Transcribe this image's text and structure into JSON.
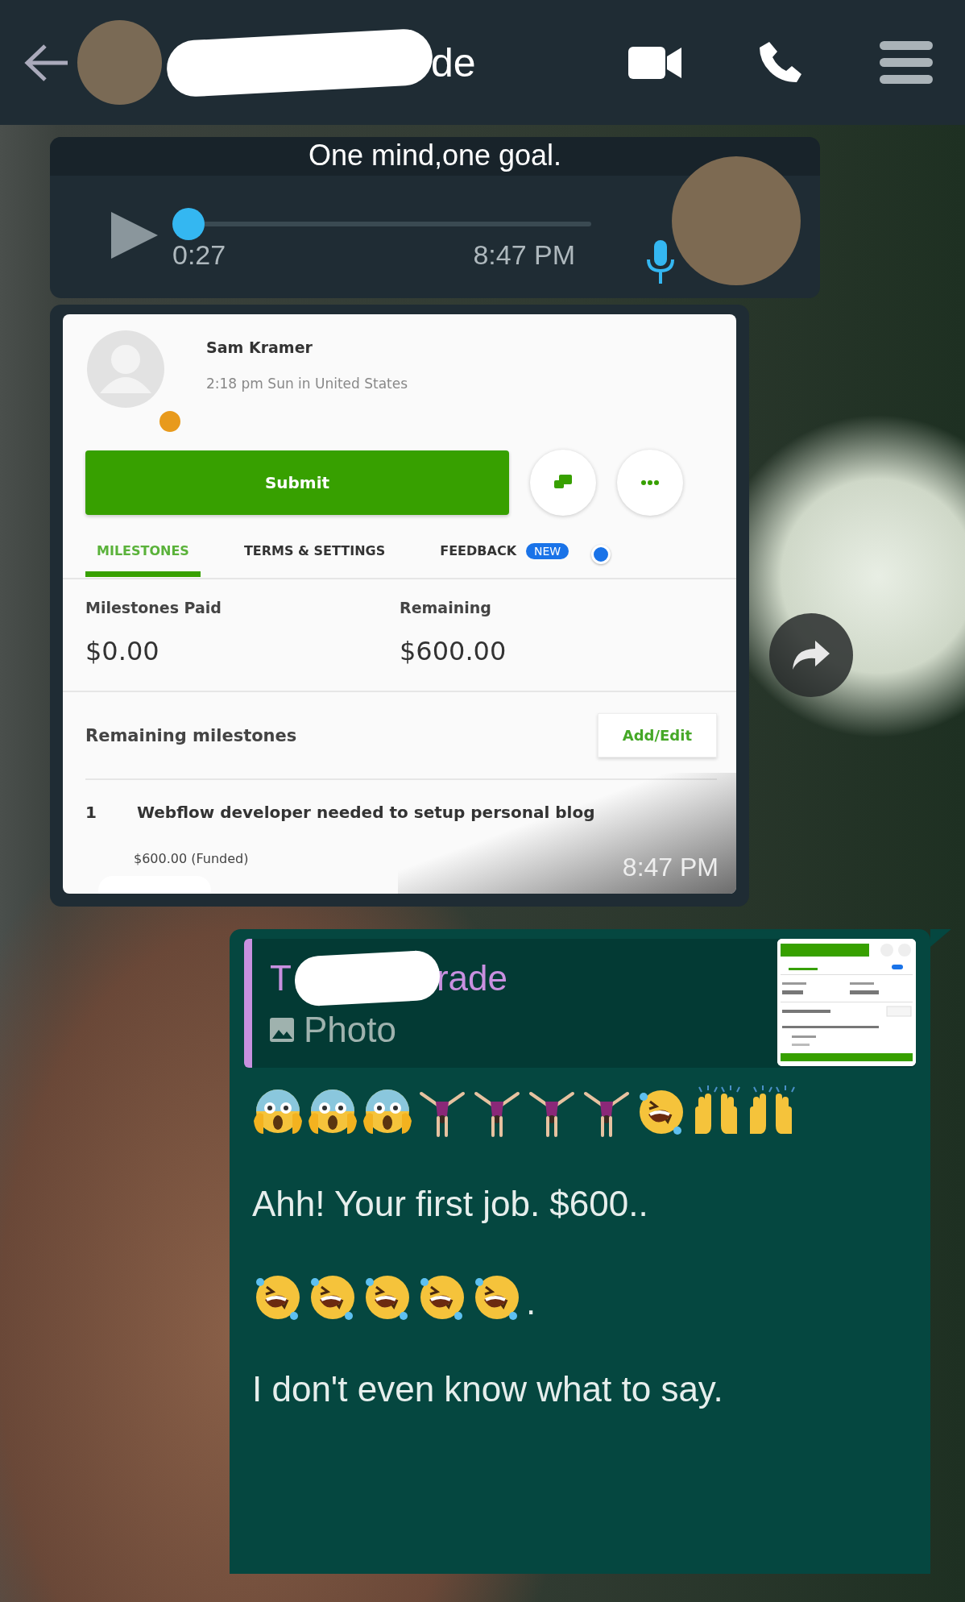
{
  "header": {
    "title_fragment": "de",
    "redacted": true
  },
  "voice_message": {
    "caption": "One mind,one goal.",
    "level": 0,
    "duration": "0:27",
    "time": "8:47 PM"
  },
  "image_message": {
    "time": "8:47 PM",
    "screenshot": {
      "contact_name": "Sam Kramer",
      "local_time": "2:18 pm Sun in United States",
      "status_dot": {
        "color": "#e89a1c"
      },
      "submit_label": "Submit",
      "tabs": [
        {
          "label": "MILESTONES",
          "selected": true
        },
        {
          "label": "TERMS & SETTINGS",
          "selected": false
        },
        {
          "label": "FEEDBACK",
          "selected": false,
          "badge": "NEW"
        }
      ],
      "stats": [
        {
          "label": "Milestones Paid",
          "value": "$0.00"
        },
        {
          "label": "Remaining",
          "value": "$600.00"
        }
      ],
      "section_title": "Remaining milestones",
      "add_edit_label": "Add/Edit",
      "milestones": [
        {
          "number": "1",
          "title": "Webflow developer needed to setup personal blog",
          "amount": "$600.00 (Funded)"
        }
      ]
    }
  },
  "reply_message": {
    "quoted": {
      "author_fragments": [
        "T",
        "rade"
      ],
      "type_label": "Photo"
    },
    "lines": [
      {
        "kind": "emoji",
        "emojis": [
          {
            "kind": "scream"
          },
          {
            "kind": "scream"
          },
          {
            "kind": "scream"
          },
          {
            "kind": "cartwheel"
          },
          {
            "kind": "cartwheel"
          },
          {
            "kind": "cartwheel"
          },
          {
            "kind": "cartwheel"
          },
          {
            "kind": "rofl"
          },
          {
            "kind": "raised-hands"
          },
          {
            "kind": "raised-hands"
          }
        ]
      },
      {
        "kind": "text",
        "text": "Ahh! Your first job. $600.."
      },
      {
        "kind": "emoji",
        "emojis": [
          {
            "kind": "rofl"
          },
          {
            "kind": "rofl"
          },
          {
            "kind": "rofl"
          },
          {
            "kind": "rofl"
          },
          {
            "kind": "rofl"
          }
        ],
        "suffix": "."
      },
      {
        "kind": "text",
        "text": "I don't even know what to say."
      }
    ]
  }
}
